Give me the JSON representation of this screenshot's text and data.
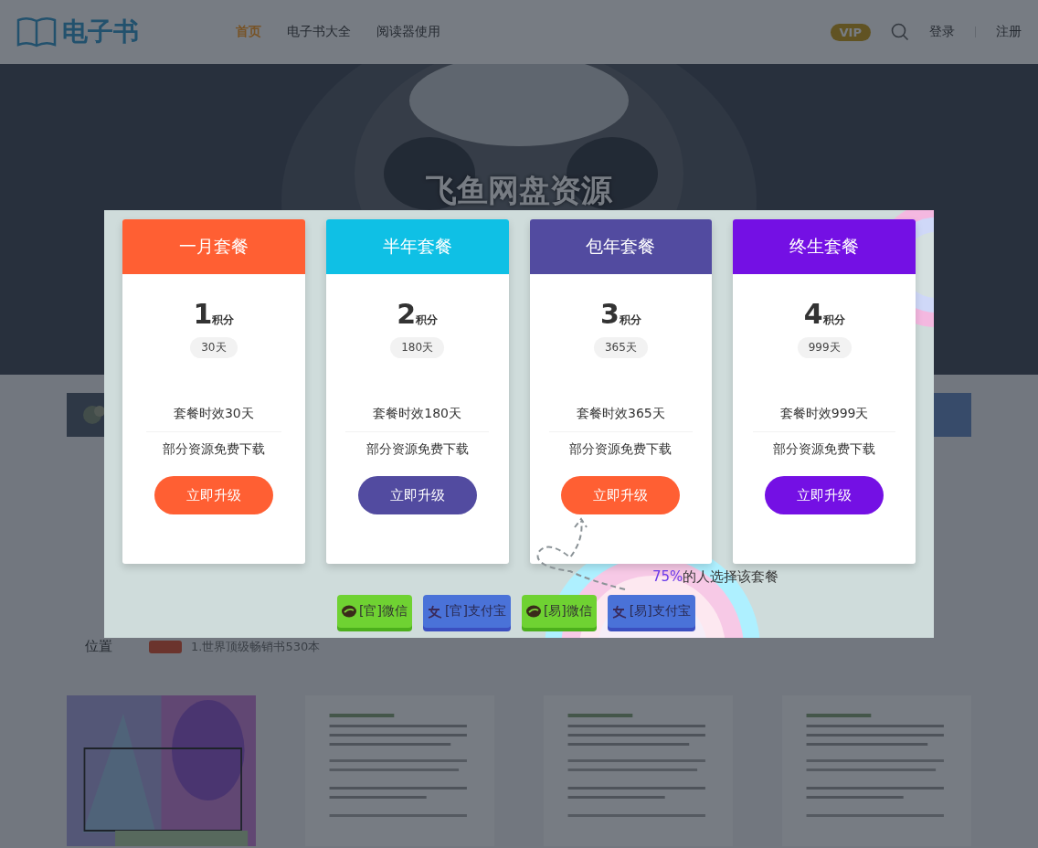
{
  "header": {
    "logo": "电子书",
    "nav": [
      {
        "label": "首页",
        "selected": true
      },
      {
        "label": "电子书大全",
        "selected": false
      },
      {
        "label": "阅读器使用",
        "selected": false
      }
    ],
    "vip": "VIP",
    "login": "登录",
    "register": "注册"
  },
  "hero": {
    "title": "飞鱼网盘资源"
  },
  "breadcrumb": {
    "label": "位置",
    "path": "1.世界顶级畅销书530本"
  },
  "plans": [
    {
      "name": "一月套餐",
      "color": "#ff5f33",
      "points": "1",
      "unit": "积分",
      "days": "30天",
      "features": [
        "套餐时效30天",
        "部分资源免费下载"
      ],
      "button": {
        "label": "立即升级",
        "color": "#ff5f33"
      }
    },
    {
      "name": "半年套餐",
      "color": "#0fc0e5",
      "points": "2",
      "unit": "积分",
      "days": "180天",
      "features": [
        "套餐时效180天",
        "部分资源免费下载"
      ],
      "button": {
        "label": "立即升级",
        "color": "#524ba0"
      }
    },
    {
      "name": "包年套餐",
      "color": "#524ba0",
      "points": "3",
      "unit": "积分",
      "days": "365天",
      "features": [
        "套餐时效365天",
        "部分资源免费下载"
      ],
      "button": {
        "label": "立即升级",
        "color": "#ff5f33"
      }
    },
    {
      "name": "终生套餐",
      "color": "#7410e4",
      "points": "4",
      "unit": "积分",
      "days": "999天",
      "features": [
        "套餐时效999天",
        "部分资源免费下载"
      ],
      "button": {
        "label": "立即升级",
        "color": "#7410e4"
      }
    }
  ],
  "note": {
    "highlight": "75%",
    "text": "的人选择该套餐"
  },
  "payments": [
    {
      "kind": "wechat",
      "label": "[官]微信"
    },
    {
      "kind": "alipay",
      "label": "[官]支付宝"
    },
    {
      "kind": "wechat",
      "label": "[易]微信"
    },
    {
      "kind": "alipay",
      "label": "[易]支付宝"
    }
  ]
}
